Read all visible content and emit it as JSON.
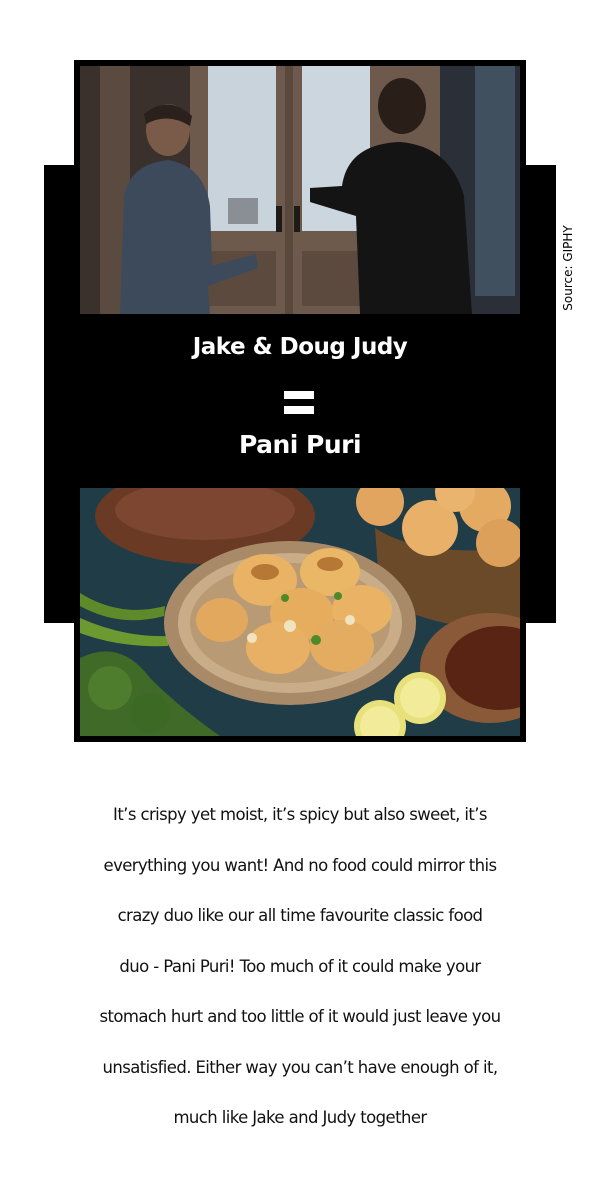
{
  "source_credit": "Source: GIPHY",
  "card": {
    "title_top": "Jake & Doug Judy",
    "equals_icon": "equals-sign-icon",
    "title_bottom": "Pani Puri"
  },
  "images": {
    "top": "two-men-handshake-at-doorway-image",
    "bottom": "pani-puri-plate-image"
  },
  "body": {
    "lines": [
      "It’s crispy yet moist, it’s spicy but also sweet, it’s",
      "everything you want! And no food could mirror this",
      "crazy duo like our all time favourite classic food",
      "duo - Pani Puri! Too much of it could make your",
      "stomach hurt and too little of it would just leave you",
      "unsatisfied. Either way you can’t have enough of it,",
      "much like Jake and Judy together"
    ]
  }
}
